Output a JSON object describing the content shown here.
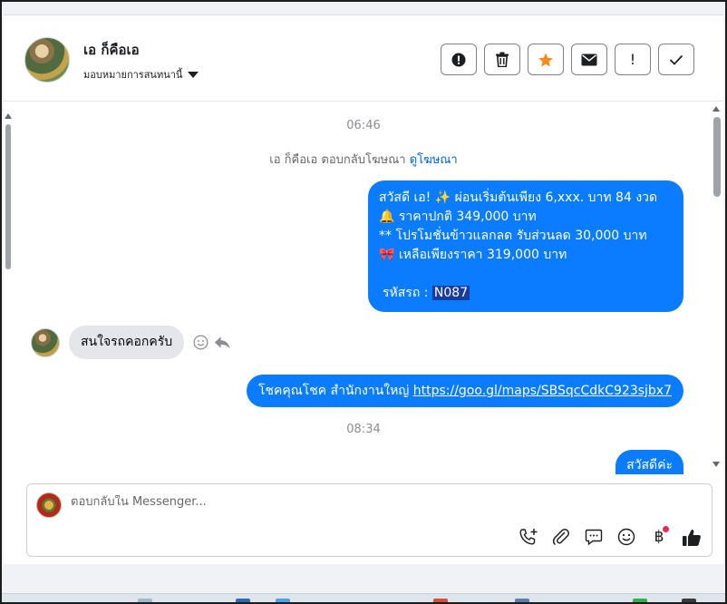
{
  "header": {
    "contact_name": "เอ ก็คือเอ",
    "assign_label": "มอบหมายการสนทนานี้",
    "actions": [
      {
        "name": "report-icon",
        "label": ""
      },
      {
        "name": "trash-icon",
        "label": ""
      },
      {
        "name": "star-icon",
        "label": ""
      },
      {
        "name": "envelope-icon",
        "label": ""
      },
      {
        "name": "exclamation-icon",
        "label": "!"
      },
      {
        "name": "check-icon",
        "label": ""
      }
    ]
  },
  "thread": {
    "time_1": "06:46",
    "ad_note_text": "เอ ก็คือเอ ตอบกลับโฆษณา",
    "ad_note_link": "ดูโฆษณา",
    "message_1_lines": [
      "สวัสดี เอ! ✨  ผ่อนเริ่มต้นเพียง 6,xxx. บาท 84 งวด",
      "🔔 ราคาปกติ 349,000 บาท",
      "** โปรโมชั่นข้าวแลกลด รับส่วนลด 30,000 บาท",
      "🎀  เหลือเพียงราคา 319,000 บาท"
    ],
    "message_1_code_label": "รหัสรถ :",
    "message_1_code": "N087",
    "incoming_message": "สนใจรถคอกครับ",
    "message_2_text": "โชคคุณโชค สำนักงานใหญ่",
    "message_2_link": "https://goo.gl/maps/SBSqcCdkC923sjbx7",
    "time_2": "08:34",
    "message_3": "สวัสดีค่ะ"
  },
  "composer": {
    "placeholder": "ตอบกลับใน Messenger...",
    "tools": [
      "phone-plus-icon",
      "paperclip-icon",
      "chat-bubble-icon",
      "emoji-icon",
      "baht-icon",
      "thumbs-up-icon"
    ],
    "baht_symbol": "฿"
  },
  "colors": {
    "accent": "#0a7cff",
    "star": "#f58b1f",
    "incoming_bubble": "#e4e6eb"
  }
}
